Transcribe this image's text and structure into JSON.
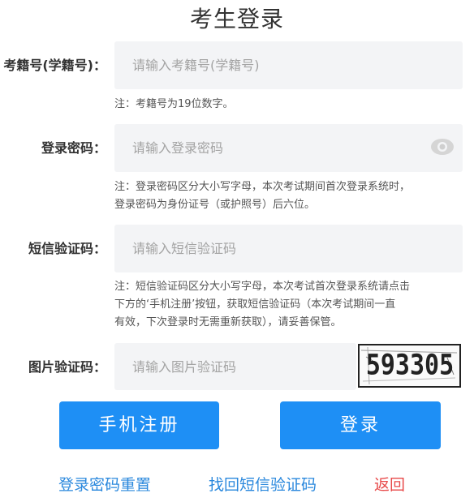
{
  "page": {
    "title": "考生登录"
  },
  "form": {
    "exam_id": {
      "label": "考籍号(学籍号)：",
      "placeholder": "请输入考籍号(学籍号)",
      "value": "",
      "note": "注：考籍号为19位数字。"
    },
    "password": {
      "label": "登录密码：",
      "placeholder": "请输入登录密码",
      "value": "",
      "note_line1": "注：登录密码区分大小写字母，本次考试期间首次登录系统时，",
      "note_line2": "登录密码为身份证号（或护照号）后六位。",
      "toggle_icon": "eye-icon"
    },
    "sms_code": {
      "label": "短信验证码：",
      "placeholder": "请输入短信验证码",
      "value": "",
      "note_line1": "注：短信验证码区分大小写字母，本次考试首次登录系统请点击",
      "note_line2": "下方的‘手机注册’按钮，获取短信验证码（本次考试期间一直",
      "note_line3": "有效，下次登录时无需重新获取），请妥善保管。"
    },
    "image_code": {
      "label": "图片验证码：",
      "placeholder": "请输入图片验证码",
      "value": "",
      "captcha_text": "593305"
    }
  },
  "buttons": {
    "register": "手机注册",
    "login": "登录"
  },
  "links": {
    "reset_password": "登录密码重置",
    "recover_sms": "找回短信验证码",
    "back": "返回"
  },
  "colors": {
    "primary": "#1e8ff5",
    "link": "#2a88dd",
    "back_link": "#e84a4a",
    "field_bg": "#f3f4f6"
  }
}
